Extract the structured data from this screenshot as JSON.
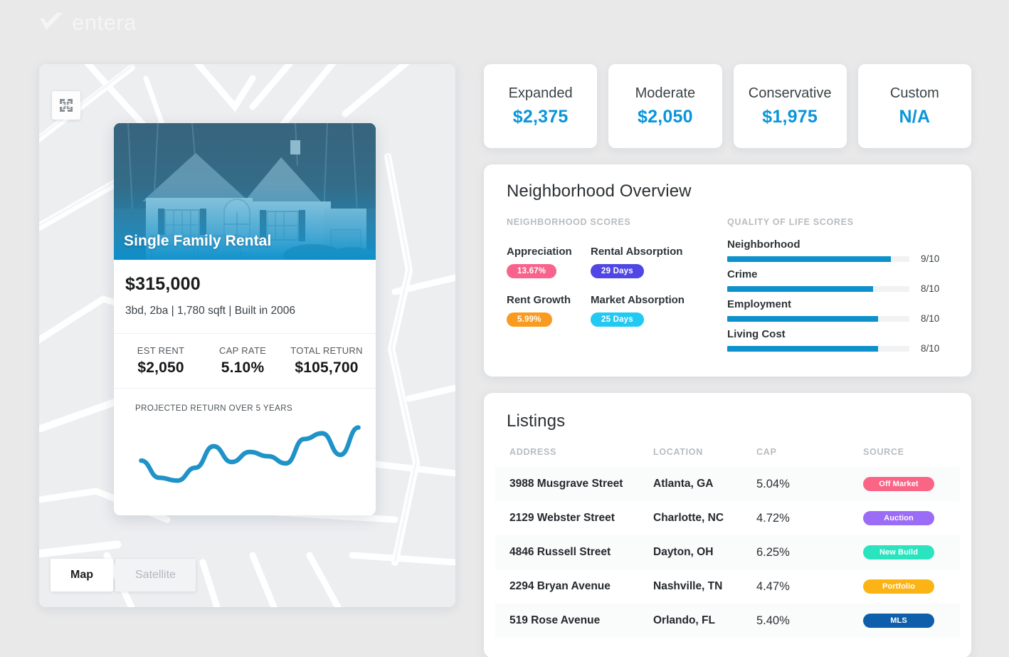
{
  "brand": {
    "name": "entera",
    "logo_icon": "entera-check-logo",
    "color": "#f4f5f6"
  },
  "map": {
    "fullscreen_icon": "collapse-fullscreen-icon",
    "types": [
      {
        "label": "Map",
        "active": true
      },
      {
        "label": "Satellite",
        "active": false
      }
    ]
  },
  "property_card": {
    "photo_alt": "house-photo",
    "type_label": "Single Family Rental",
    "price": "$315,000",
    "specs": "3bd, 2ba | 1,780 sqft | Built in 2006",
    "stats": [
      {
        "label": "EST RENT",
        "value": "$2,050"
      },
      {
        "label": "CAP RATE",
        "value": "5.10%"
      },
      {
        "label": "TOTAL RETURN",
        "value": "$105,700"
      }
    ],
    "chart_title": "PROJECTED RETURN OVER 5 YEARS",
    "chart_color": "#1f93c7"
  },
  "rent_tiles": [
    {
      "label": "Expanded",
      "value": "$2,375"
    },
    {
      "label": "Moderate",
      "value": "$2,050"
    },
    {
      "label": "Conservative",
      "value": "$1,975"
    },
    {
      "label": "Custom",
      "value": "N/A"
    }
  ],
  "neighborhood": {
    "title": "Neighborhood Overview",
    "scores_label": "NEIGHBORHOOD SCORES",
    "qol_label": "QUALITY OF LIFE SCORES",
    "scores": [
      {
        "name": "Appreciation",
        "value": "13.67%",
        "color": "#f9628c"
      },
      {
        "name": "Rental Absorption",
        "value": "29 Days",
        "color": "#4f46e5"
      },
      {
        "name": "Rent Growth",
        "value": "5.99%",
        "color": "#f99b1e"
      },
      {
        "name": "Market Absorption",
        "value": "25 Days",
        "color": "#22c9f2"
      }
    ],
    "quality_of_life": [
      {
        "name": "Neighborhood",
        "score": "9/10",
        "percent": 90
      },
      {
        "name": "Crime",
        "score": "8/10",
        "percent": 80
      },
      {
        "name": "Employment",
        "score": "8/10",
        "percent": 83
      },
      {
        "name": "Living Cost",
        "score": "8/10",
        "percent": 83
      }
    ],
    "bar_color": "#0d91cc"
  },
  "listings": {
    "title": "Listings",
    "columns": [
      "ADDRESS",
      "LOCATION",
      "CAP",
      "SOURCE"
    ],
    "rows": [
      {
        "address": "3988 Musgrave Street",
        "location": "Atlanta, GA",
        "cap": "5.04%",
        "source": "Off Market",
        "source_color": "#fa6585"
      },
      {
        "address": "2129 Webster Street",
        "location": "Charlotte, NC",
        "cap": "4.72%",
        "source": "Auction",
        "source_color": "#9b6cf5"
      },
      {
        "address": "4846 Russell Street",
        "location": "Dayton, OH",
        "cap": "6.25%",
        "source": "New Build",
        "source_color": "#2ae4c0"
      },
      {
        "address": "2294 Bryan Avenue",
        "location": "Nashville, TN",
        "cap": "4.47%",
        "source": "Portfolio",
        "source_color": "#fcb415"
      },
      {
        "address": "519 Rose Avenue",
        "location": "Orlando, FL",
        "cap": "5.40%",
        "source": "MLS",
        "source_color": "#0f5eab"
      }
    ]
  },
  "chart_data": {
    "type": "line",
    "title": "PROJECTED RETURN OVER 5 YEARS",
    "xlabel": "",
    "ylabel": "",
    "x": [
      0,
      1,
      2,
      3,
      4,
      5,
      6,
      7,
      8,
      9,
      10,
      11,
      12
    ],
    "values": [
      52,
      76,
      80,
      62,
      32,
      54,
      40,
      46,
      56,
      22,
      14,
      44,
      6
    ],
    "ylim": [
      0,
      100
    ],
    "grid": false,
    "legend": "none",
    "series_color": "#1f93c7"
  }
}
